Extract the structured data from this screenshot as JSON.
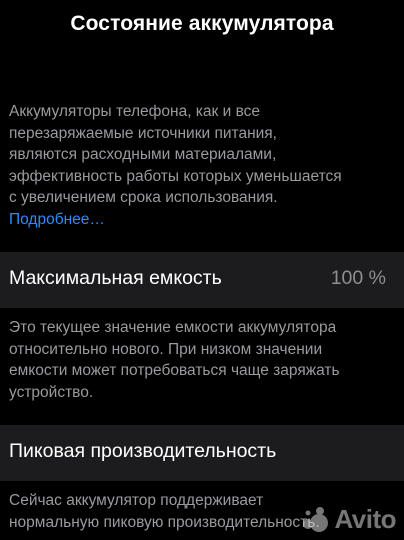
{
  "header": {
    "title": "Состояние аккумулятора"
  },
  "intro": {
    "lines": [
      "Аккумуляторы телефона, как и все",
      "перезаряжаемые источники питания,",
      "являются расходными материалами,",
      "эффективность работы которых уменьшается",
      "с увеличением срока использования."
    ],
    "link_label": "Подробнее…",
    "link_color": "#2f8bff"
  },
  "max_capacity": {
    "label": "Максимальная емкость",
    "value": "100 %",
    "note_lines": [
      "Это текущее значение емкости аккумулятора",
      "относительно нового. При низком значении",
      "емкости может потребоваться чаще заряжать",
      "устройство."
    ]
  },
  "peak_performance": {
    "label": "Пиковая производительность",
    "note_lines": [
      "Сейчас аккумулятор поддерживает",
      "нормальную пиковую производительность."
    ]
  },
  "watermark": {
    "text": "Avito",
    "icon": "avito-logo-icon"
  },
  "colors": {
    "background": "#000000",
    "cell_background": "#1c1c1e",
    "secondary_text": "#9a9a9f",
    "accent": "#2f8bff"
  }
}
